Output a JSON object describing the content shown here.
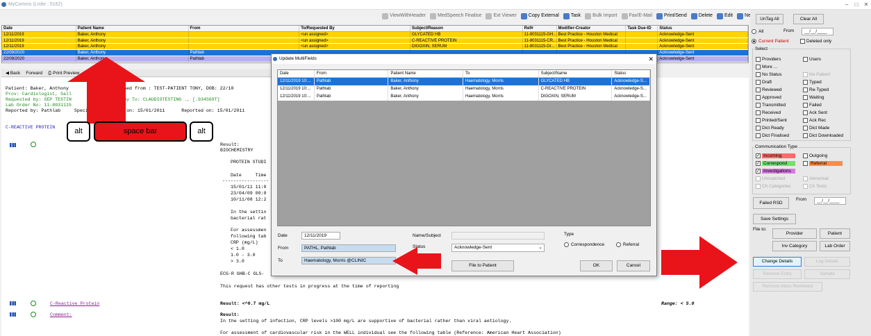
{
  "window": {
    "title": "MyComms (Lrobr : 5162)"
  },
  "toolbar": [
    {
      "label": "ViewWithHeader",
      "icon": "view-header-icon",
      "enabled": false
    },
    {
      "label": "MedSpeech Finalise",
      "icon": "medspeech-icon",
      "enabled": false
    },
    {
      "label": "Ext Viewer",
      "icon": "ext-viewer-icon",
      "enabled": false
    },
    {
      "label": "Copy External",
      "icon": "copy-icon",
      "enabled": true
    },
    {
      "label": "Task",
      "icon": "task-icon",
      "enabled": true
    },
    {
      "label": "Bulk Import",
      "icon": "bulk-import-icon",
      "enabled": false
    },
    {
      "label": "Fax/E-Mail",
      "icon": "fax-icon",
      "enabled": false
    },
    {
      "label": "Print/Send",
      "icon": "print-icon",
      "enabled": true
    },
    {
      "label": "Delete",
      "icon": "delete-icon",
      "enabled": true
    },
    {
      "label": "Edit",
      "icon": "edit-icon",
      "enabled": true
    },
    {
      "label": "New",
      "icon": "new-icon",
      "enabled": true
    }
  ],
  "grid": {
    "columns": [
      "Date",
      "Patient Name",
      "From",
      "To/Requested By",
      "Subject/Reason",
      "Ref#",
      "Modifier-Creator",
      "Task Due-ID",
      "Status"
    ],
    "rows": [
      {
        "style": "gy",
        "cells": [
          "12/11/2019",
          "Baker, Anthony",
          "",
          "<un assigned>",
          "GLYCATED HB",
          "11-8031115-GH...",
          "Best Practice - Houston Medical",
          "",
          "Acknowledge-Sent"
        ]
      },
      {
        "style": "gy",
        "cells": [
          "12/11/2019",
          "Baker, Anthony",
          "",
          "<un assigned>",
          "C-REACTIVE PROTEIN",
          "11-8031115-CR...",
          "Best Practice - Houston Medical",
          "",
          "Acknowledge-Sent"
        ]
      },
      {
        "style": "gy",
        "cells": [
          "12/11/2019",
          "Baker, Anthony",
          "",
          "<un assigned>",
          "DIGOXIN, SERUM",
          "11-8031115-DI...",
          "Best Practice - Houston Medical",
          "",
          "Acknowledge-Sent"
        ]
      },
      {
        "style": "gb",
        "cells": [
          "22/09/2020",
          "Baker, Anthony",
          "Pathlab",
          "",
          "",
          "",
          "",
          "",
          "Acknowledge-Sent"
        ]
      },
      {
        "style": "gp",
        "cells": [
          "22/09/2020",
          "Baker, Anthony",
          "Pathlab",
          "",
          "",
          "",
          "",
          "",
          "Acknowledge-Sent"
        ]
      }
    ]
  },
  "nav": {
    "back": "Back",
    "forward": "Forward",
    "print": "Print Preview"
  },
  "document": {
    "patient_line": "Patient: Baker, Anthony        9/1989 (Matched from : TEST-PATIENT TONY, DOB: 22/10",
    "provider_line": "Prov: Cardiologist, Sall",
    "requested_line": "Requested by: SEP TESTIN      [.234569T] Copy To: CLAUDIOTESTING ., [.934569T]",
    "lab_order_line": "Lab Order No: 11-8031115",
    "reported_line": "Reported by: Pathlab     Specimen Collected on: 15/01/2011      Reported on: 15/01/2011",
    "section_title": "C-REACTIVE PROTEIN",
    "result_label": "Result:",
    "biochem": "BIOCHEMISTRY",
    "protein_studies": "PROTEIN STUDI",
    "table_header": "Date     Time",
    "table_rule": "-----------------",
    "table_rows": [
      "15/01/11 11:0",
      "23/04/09 00:0",
      "10/11/08 12:2"
    ],
    "setting1": "In the settin",
    "setting2": "bacterial rat",
    "assess1": "For assessmen",
    "assess2": "following tab",
    "crp_unit": "CRP (mg/L)",
    "crp_lt": "< 1.0",
    "crp_mid": "1.0 - 3.0",
    "crp_gt": "> 3.0",
    "ecg": "ECG-R GHB-C GLS-",
    "other_tests": "This request has other tests in progress at the time of reporting",
    "crp_link": "C-Reactive Protein",
    "crp_result": "Result: <^0.7 mg/L",
    "range": "Range: < 5.0",
    "comment_link": "Comment:",
    "comment_result": "Result:",
    "comment_text": "In the setting of infection, CRP levels >100 mg/L are supportive of bacterial rather than viral aetiology.",
    "comment_text2": "For assessment of cardiovascular risk in the WELL individual see the following table (Reference: American Heart Association)"
  },
  "keys": {
    "alt_left": "alt",
    "space": "space bar",
    "alt_right": "alt"
  },
  "dialog": {
    "title": "Update MultiFields",
    "columns": [
      "Date",
      "From",
      "Patient Name",
      "To",
      "Subject/Name",
      "Status"
    ],
    "rows": [
      [
        "12/11/2019 10:...",
        "Pathlab",
        "Baker, Anthony",
        "Haematology, Morris",
        "GLYCATED HB",
        "Acknowledge-S..."
      ],
      [
        "12/11/2019 10:...",
        "Pathlab",
        "Baker, Anthony",
        "Haematology, Morris",
        "C-REACTIVE PROTEIN",
        "Acknowledge-S..."
      ],
      [
        "12/11/2019 10:...",
        "Pathlab",
        "Baker, Anthony",
        "Haematology, Morris",
        "DIGOXIN, SERUM",
        "Acknowledge-S..."
      ]
    ],
    "date_label": "Date",
    "date_value": "12/11/2019",
    "from_label": "From",
    "from_value": "PATHL, Pathlab",
    "to_label": "To",
    "to_value": "Haematology, Morris @CLINIC",
    "name_subject_label": "Name/Subject",
    "status_label": "Status",
    "status_value": "Acknowledge-Sent",
    "type_label": "Type",
    "type_options": [
      "Correspondence",
      "Referral"
    ],
    "file_to_patient": "File to Patient",
    "ok": "OK",
    "cancel": "Cancel"
  },
  "sidebar": {
    "untag_all": "UnTag All",
    "clear_all": "Clear All",
    "all": "All",
    "current_patient": "Current Patient",
    "from_label": "From",
    "from_date": "__/__/____",
    "deleted_only": "Deleted only",
    "select_label": "Select",
    "select_items": [
      {
        "label": "Providers",
        "enabled": true
      },
      {
        "label": "Users",
        "enabled": true
      },
      {
        "label": "More ...",
        "enabled": true
      },
      {
        "label": "",
        "enabled": true
      },
      {
        "label": "No Status",
        "enabled": true
      },
      {
        "label": "No Patient",
        "enabled": false
      },
      {
        "label": "Draft",
        "enabled": true
      },
      {
        "label": "Typed",
        "enabled": true
      },
      {
        "label": "Reviewed",
        "enabled": true
      },
      {
        "label": "Re-Typed",
        "enabled": true
      },
      {
        "label": "Approved",
        "enabled": true
      },
      {
        "label": "Waiting",
        "enabled": true
      },
      {
        "label": "Transmitted",
        "enabled": true
      },
      {
        "label": "Failed",
        "enabled": true
      },
      {
        "label": "Received",
        "enabled": true
      },
      {
        "label": "Ack Sent",
        "enabled": true
      },
      {
        "label": "Printed/Sent",
        "enabled": true
      },
      {
        "label": "Ack Rec",
        "enabled": true
      },
      {
        "label": "Dict Ready",
        "enabled": true
      },
      {
        "label": "Dict Made",
        "enabled": true
      },
      {
        "label": "Dict Finalised",
        "enabled": true
      },
      {
        "label": "Dict Downloaded",
        "enabled": true
      }
    ],
    "comm_type_label": "Communication Type",
    "comm_items": [
      {
        "label": "Incoming",
        "checked": true,
        "color": "#ff6b6b",
        "enabled": true
      },
      {
        "label": "Outgoing",
        "checked": false,
        "color": "",
        "enabled": true
      },
      {
        "label": "Correspond",
        "checked": true,
        "color": "#6fe36f",
        "enabled": true
      },
      {
        "label": "Referral",
        "checked": false,
        "color": "#ff8c42",
        "enabled": true
      },
      {
        "label": "Investigations",
        "checked": true,
        "color": "#d67ae0",
        "enabled": true
      },
      {
        "label": "",
        "checked": false,
        "color": "",
        "enabled": true
      },
      {
        "label": "Unmatched",
        "checked": false,
        "color": "",
        "enabled": false
      },
      {
        "label": "Abnormal",
        "checked": false,
        "color": "",
        "enabled": false
      },
      {
        "label": "Ch Categories",
        "checked": false,
        "color": "",
        "enabled": false
      },
      {
        "label": "Ch Tests",
        "checked": false,
        "color": "",
        "enabled": false
      }
    ],
    "failed_rsd": "Failed RSD",
    "failed_from": "From",
    "failed_date": "__/__/____",
    "save_settings": "Save Settings",
    "file_to": "File to:",
    "provider": "Provider",
    "patient": "Patient",
    "inv_category": "Inv Category",
    "lab_order": "Lab Order",
    "change_details": "Change Details",
    "log_details": "Log Details",
    "remove_entry": "Remove Entry",
    "sample": "Sample",
    "remove_reviewed": "Remove Inbox Reviewed"
  }
}
